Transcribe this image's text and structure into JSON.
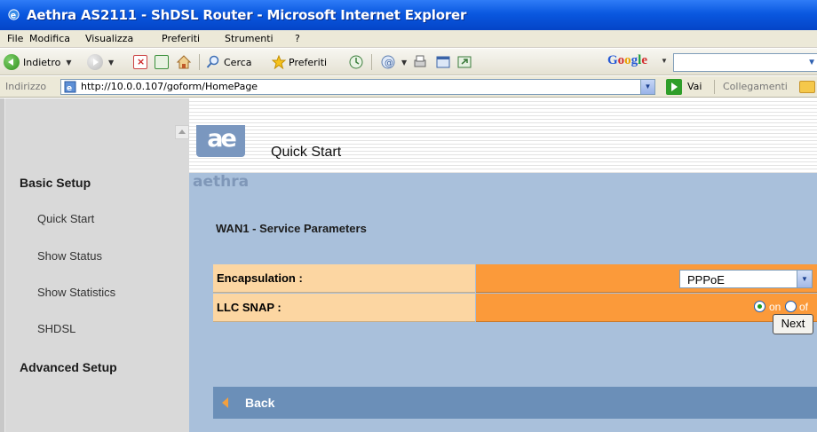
{
  "window": {
    "title": "Aethra AS2111 - ShDSL Router - Microsoft Internet Explorer"
  },
  "menu": [
    "File",
    "Modifica",
    "Visualizza",
    "Preferiti",
    "Strumenti",
    "?"
  ],
  "toolbar": {
    "back_label": "Indietro",
    "search_label": "Cerca",
    "favorites_label": "Preferiti",
    "google_logo": [
      "G",
      "o",
      "o",
      "g",
      "l",
      "e"
    ],
    "google_search_value": ""
  },
  "address": {
    "label": "Indirizzo",
    "url": "http://10.0.0.107/goform/HomePage",
    "go_label": "Vai",
    "links_label": "Collegamenti"
  },
  "nav": {
    "basic_setup": "Basic Setup",
    "items": [
      "Quick Start",
      "Show Status",
      "Show Statistics",
      "SHDSL"
    ],
    "advanced_setup": "Advanced Setup"
  },
  "brand": {
    "logo_mark": "ae",
    "logo_word": "aethra",
    "logo_color": "#7a97bf"
  },
  "page": {
    "title": "Quick Start",
    "section_title": "WAN1 - Service Parameters"
  },
  "form": {
    "encapsulation_label": "Encapsulation :",
    "encapsulation_value": "PPPoE",
    "llc_snap_label": "LLC SNAP :",
    "llc_on_label": "on",
    "llc_off_label": "of",
    "llc_selected": "on",
    "next_label": "Next"
  },
  "back": {
    "label": "Back"
  },
  "colors": {
    "titlebar": "#0a58e0",
    "panel_bg": "#a9c0db",
    "label_cell": "#fcd6a2",
    "value_cell": "#fb9a3a",
    "back_bar": "#6b8fb8"
  }
}
